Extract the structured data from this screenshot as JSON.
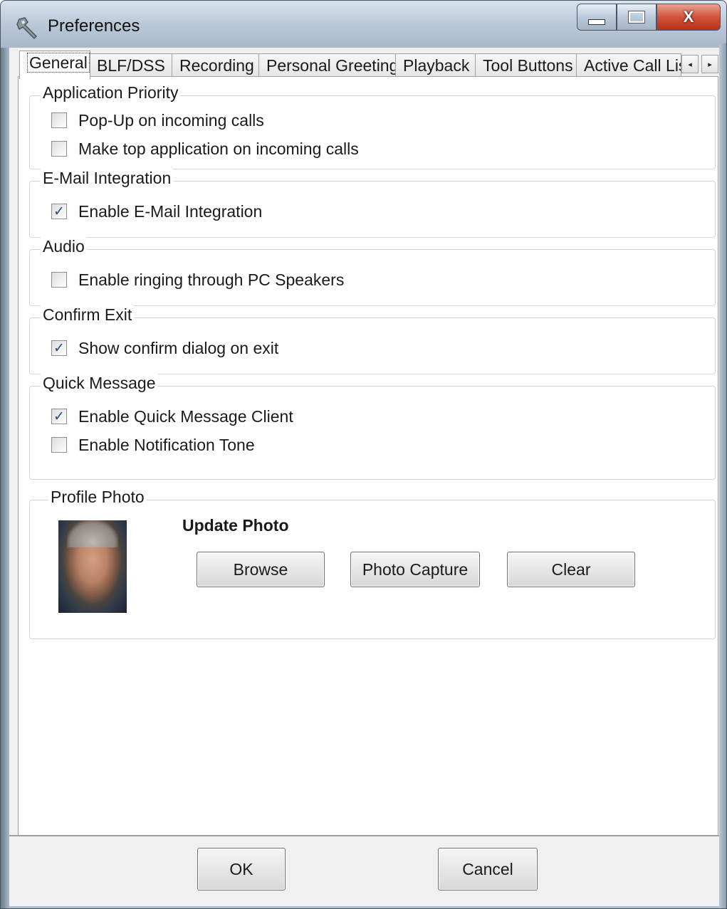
{
  "window": {
    "title": "Preferences",
    "icon": "wrench-icon",
    "minimize_icon": "minimize-icon",
    "maximize_icon": "maximize-icon",
    "close_glyph": "X"
  },
  "tabs": {
    "items": [
      {
        "label": "General",
        "active": true
      },
      {
        "label": "BLF/DSS"
      },
      {
        "label": "Recording"
      },
      {
        "label": "Personal Greeting"
      },
      {
        "label": "Playback"
      },
      {
        "label": "Tool Buttons"
      },
      {
        "label": "Active Call Lis"
      }
    ],
    "scroll_left_glyph": "◂",
    "scroll_right_glyph": "▸"
  },
  "groups": {
    "application_priority": {
      "title": "Application Priority",
      "options": [
        {
          "label": "Pop-Up on incoming calls",
          "checked": false
        },
        {
          "label": "Make top application on incoming calls",
          "checked": false
        }
      ]
    },
    "email_integration": {
      "title": "E-Mail Integration",
      "options": [
        {
          "label": "Enable E-Mail Integration",
          "checked": true
        }
      ]
    },
    "audio": {
      "title": "Audio",
      "options": [
        {
          "label": "Enable ringing through PC Speakers",
          "checked": false
        }
      ]
    },
    "confirm_exit": {
      "title": "Confirm Exit",
      "options": [
        {
          "label": "Show confirm dialog on exit",
          "checked": true
        }
      ]
    },
    "quick_message": {
      "title": "Quick Message",
      "options": [
        {
          "label": "Enable Quick Message Client",
          "checked": true
        },
        {
          "label": "Enable Notification Tone",
          "checked": false
        }
      ]
    },
    "profile_photo": {
      "title": "Profile Photo",
      "update_label": "Update Photo",
      "browse_label": "Browse",
      "capture_label": "Photo Capture",
      "clear_label": "Clear"
    }
  },
  "footer": {
    "ok_label": "OK",
    "cancel_label": "Cancel"
  },
  "check_glyph": "✓"
}
